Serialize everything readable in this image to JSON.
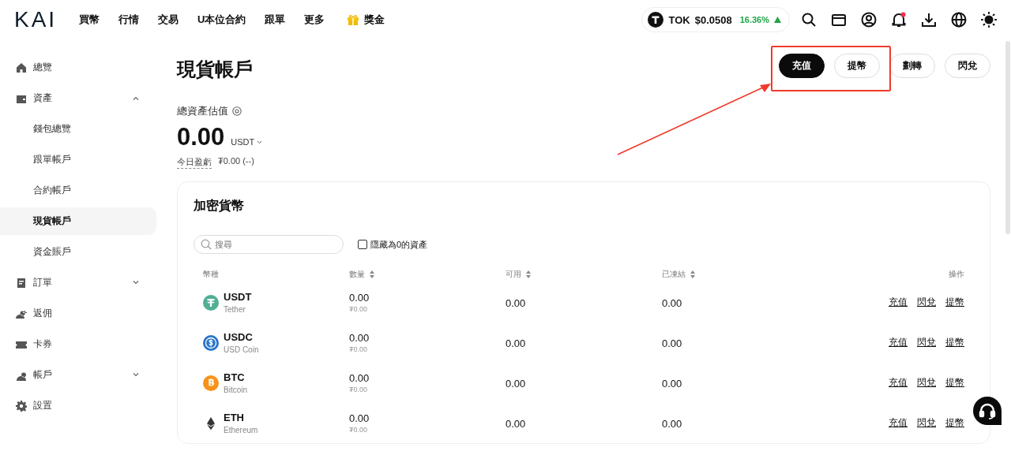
{
  "header": {
    "logo": "KAI",
    "nav": [
      "買幣",
      "行情",
      "交易",
      "U本位合約",
      "跟單",
      "更多"
    ],
    "reward": "獎金",
    "ticker": {
      "symbol": "TOK",
      "price": "$0.0508",
      "change": "16.36%",
      "rising": true
    }
  },
  "sidebar": {
    "items": [
      {
        "label": "總覽",
        "selected": false
      },
      {
        "label": "資產",
        "selected": false,
        "expanded": true,
        "children": [
          {
            "label": "錢包總覽",
            "selected": false
          },
          {
            "label": "跟單帳戶",
            "selected": false
          },
          {
            "label": "合約帳戶",
            "selected": false
          },
          {
            "label": "現貨帳戶",
            "selected": true
          },
          {
            "label": "資金賬戶",
            "selected": false
          }
        ]
      },
      {
        "label": "訂單",
        "selected": false,
        "expanded": false
      },
      {
        "label": "返佣",
        "selected": false
      },
      {
        "label": "卡券",
        "selected": false
      },
      {
        "label": "帳戶",
        "selected": false,
        "expanded": false
      },
      {
        "label": "設置",
        "selected": false
      }
    ]
  },
  "page": {
    "title": "現貨帳戶",
    "actions": [
      {
        "label": "充值",
        "primary": true
      },
      {
        "label": "提幣",
        "primary": false
      },
      {
        "label": "劃轉",
        "primary": false
      },
      {
        "label": "閃兌",
        "primary": false
      }
    ],
    "balance": {
      "label": "總資產估值",
      "value": "0.00",
      "unit": "USDT",
      "pnl_label": "今日盈虧",
      "pnl": "₮0.00 (--)"
    }
  },
  "assets": {
    "title": "加密貨幣",
    "search": {
      "placeholder": "搜尋"
    },
    "hide_zero": {
      "label": "隱藏為0的資產",
      "checked": false
    },
    "columns": [
      {
        "label": "幣種",
        "sortable": false
      },
      {
        "label": "數量",
        "sortable": true
      },
      {
        "label": "可用",
        "sortable": true
      },
      {
        "label": "已凍結",
        "sortable": true
      },
      {
        "label": "操作",
        "sortable": false
      }
    ],
    "rows": [
      {
        "symbol": "USDT",
        "name": "Tether",
        "color": "#50af95",
        "amount": "0.00",
        "amount_value": "₮0.00",
        "available": "0.00",
        "frozen": "0.00",
        "actions": [
          "充值",
          "閃兌",
          "提幣"
        ]
      },
      {
        "symbol": "USDC",
        "name": "USD Coin",
        "color": "#2775ca",
        "amount": "0.00",
        "amount_value": "₮0.00",
        "available": "0.00",
        "frozen": "0.00",
        "actions": [
          "充值",
          "閃兌",
          "提幣"
        ]
      },
      {
        "symbol": "BTC",
        "name": "Bitcoin",
        "color": "#f7931a",
        "amount": "0.00",
        "amount_value": "₮0.00",
        "available": "0.00",
        "frozen": "0.00",
        "actions": [
          "充值",
          "閃兌",
          "提幣"
        ]
      },
      {
        "symbol": "ETH",
        "name": "Ethereum",
        "color": "#343434",
        "amount": "0.00",
        "amount_value": "₮0.00",
        "available": "0.00",
        "frozen": "0.00",
        "actions": [
          "充值",
          "閃兌",
          "提幣"
        ]
      }
    ]
  }
}
